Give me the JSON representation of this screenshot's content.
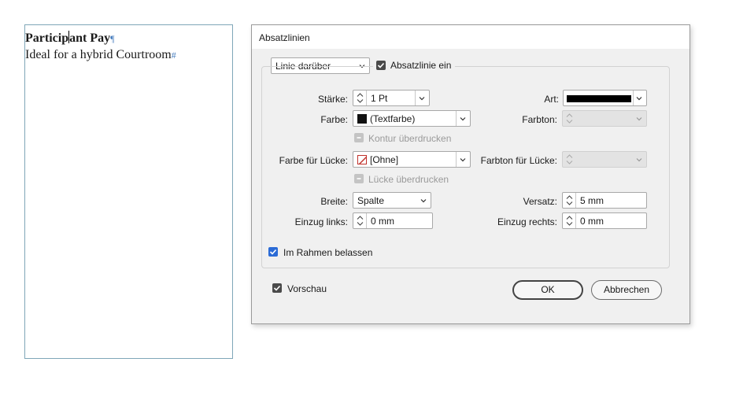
{
  "document": {
    "line1": "Participant Pay",
    "line2": "Ideal for a hybrid Courtroom",
    "pilcrow": "¶",
    "end_mark": "#"
  },
  "dialog": {
    "title": "Absatzlinien",
    "position_select": "Linie darüber",
    "rule_on_label": "Absatzlinie ein",
    "rule_on_checked": true,
    "weight_label": "Stärke:",
    "weight_value": "1 Pt",
    "type_label": "Art:",
    "color_label": "Farbe:",
    "color_value": "(Textfarbe)",
    "tint_label": "Farbton:",
    "overprint_stroke_label": "Kontur überdrucken",
    "gap_color_label": "Farbe für Lücke:",
    "gap_color_value": "[Ohne]",
    "gap_tint_label": "Farbton für Lücke:",
    "overprint_gap_label": "Lücke überdrucken",
    "width_label": "Breite:",
    "width_value": "Spalte",
    "offset_label": "Versatz:",
    "offset_value": "5 mm",
    "left_indent_label": "Einzug links:",
    "left_indent_value": "0 mm",
    "right_indent_label": "Einzug rechts:",
    "right_indent_value": "0 mm",
    "keep_in_frame_label": "Im Rahmen belassen",
    "keep_in_frame_checked": true,
    "preview_label": "Vorschau",
    "preview_checked": true,
    "ok_label": "OK",
    "cancel_label": "Abbrechen"
  },
  "colors": {
    "accent_checkbox": "#2b6bd6",
    "frame_border": "#7fa6b8",
    "none_swatch_slash": "#c0302a"
  }
}
